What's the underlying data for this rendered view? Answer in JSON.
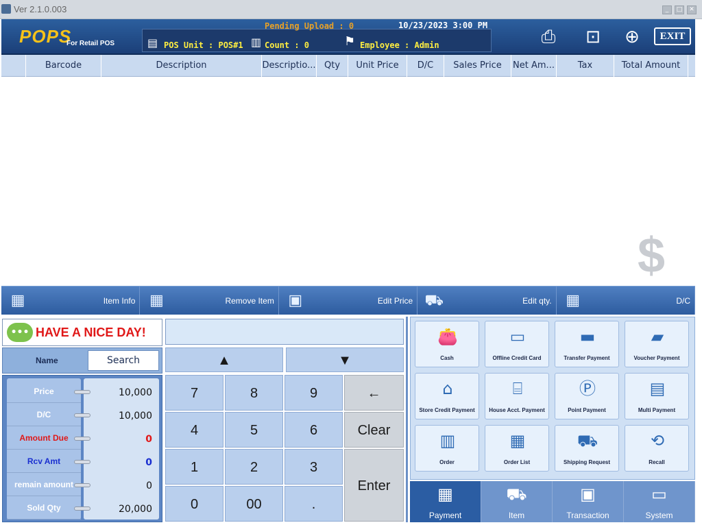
{
  "window": {
    "version": "Ver 2.1.0.003"
  },
  "header": {
    "logo": "POPS",
    "logo_sub": "For Retail POS",
    "pending_upload": "Pending Upload : 0",
    "datetime": "10/23/2023 3:00 PM",
    "pos_unit": "POS Unit : POS#1",
    "count": "Count : 0",
    "employee": "Employee : Admin",
    "exit_label": "EXIT"
  },
  "table": {
    "columns": [
      "",
      "Barcode",
      "Description",
      "Descriptio...",
      "Qty",
      "Unit Price",
      "D/C",
      "Sales Price",
      "Net Am...",
      "Tax",
      "Total Amount"
    ]
  },
  "actions": [
    "Item Info",
    "Remove Item",
    "Edit Price",
    "Edit qty.",
    "D/C"
  ],
  "greeting": "HAVE A NICE DAY!",
  "name_label": "Name",
  "search_label": "Search",
  "info": [
    {
      "label": "Price",
      "value": "10,000",
      "label_color": "#ffffff",
      "value_color": "#111111"
    },
    {
      "label": "D/C",
      "value": "10,000",
      "label_color": "#ffffff",
      "value_color": "#111111"
    },
    {
      "label": "Amount Due",
      "value": "0",
      "label_color": "#e01818",
      "value_color": "#e01818"
    },
    {
      "label": "Rcv Amt",
      "value": "0",
      "label_color": "#1a2fd0",
      "value_color": "#1a2fd0"
    },
    {
      "label": "remain amount",
      "value": "0",
      "label_color": "#ffffff",
      "value_color": "#111111"
    },
    {
      "label": "Sold Qty",
      "value": "20,000",
      "label_color": "#ffffff",
      "value_color": "#111111"
    }
  ],
  "keypad": {
    "up": "▲",
    "down": "▼",
    "keys": [
      "7",
      "8",
      "9",
      "4",
      "5",
      "6",
      "1",
      "2",
      "3",
      "0",
      "00",
      "."
    ],
    "backspace": "←",
    "clear": "Clear",
    "enter": "Enter"
  },
  "payments": [
    {
      "label": "Cash",
      "icon": "wallet-icon"
    },
    {
      "label": "Offline Credit Card",
      "icon": "credit-card-icon"
    },
    {
      "label": "Transfer Payment",
      "icon": "laptop-icon"
    },
    {
      "label": "Voucher Payment",
      "icon": "gift-card-icon"
    },
    {
      "label": "Store Credit Payment",
      "icon": "store-icon"
    },
    {
      "label": "House Acct. Payment",
      "icon": "basket-icon"
    },
    {
      "label": "Point Payment",
      "icon": "points-icon"
    },
    {
      "label": "Multi Payment",
      "icon": "multi-card-icon"
    },
    {
      "label": "Order",
      "icon": "order-icon"
    },
    {
      "label": "Order List",
      "icon": "order-list-icon"
    },
    {
      "label": "Shipping Request",
      "icon": "truck-icon"
    },
    {
      "label": "Recall",
      "icon": "recall-icon"
    }
  ],
  "tabs": [
    "Payment",
    "Item",
    "Transaction",
    "System"
  ],
  "colors": {
    "header": "#1f4a87",
    "accent": "#f5c21a",
    "amount_due": "#e01818",
    "rcv_amt": "#1a2fd0"
  }
}
